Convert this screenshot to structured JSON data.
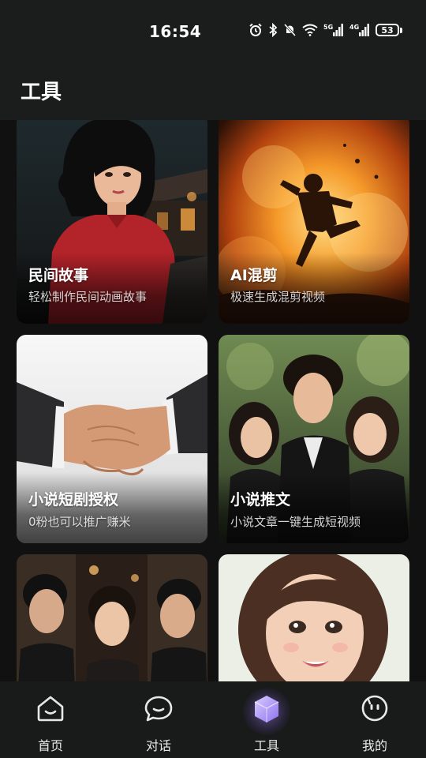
{
  "status": {
    "time": "16:54",
    "battery": "53",
    "network_1": "5G",
    "network_2": "4G"
  },
  "header": {
    "title": "工具"
  },
  "cards": [
    {
      "title": "民间故事",
      "subtitle": "轻松制作民间动画故事"
    },
    {
      "title": "AI混剪",
      "subtitle": "极速生成混剪视频"
    },
    {
      "title": "小说短剧授权",
      "subtitle": "0粉也可以推广赚米"
    },
    {
      "title": "小说推文",
      "subtitle": "小说文章一键生成短视频"
    },
    {
      "title": "",
      "subtitle": ""
    },
    {
      "title": "",
      "subtitle": ""
    }
  ],
  "nav": [
    {
      "label": "首页",
      "icon": "home-icon",
      "active": false
    },
    {
      "label": "对话",
      "icon": "chat-bubble-icon",
      "active": false
    },
    {
      "label": "工具",
      "icon": "cube-icon",
      "active": true
    },
    {
      "label": "我的",
      "icon": "profile-face-icon",
      "active": false
    }
  ],
  "colors": {
    "accent": "#b49cff",
    "background": "#111111",
    "bar": "#1b1c1c"
  }
}
